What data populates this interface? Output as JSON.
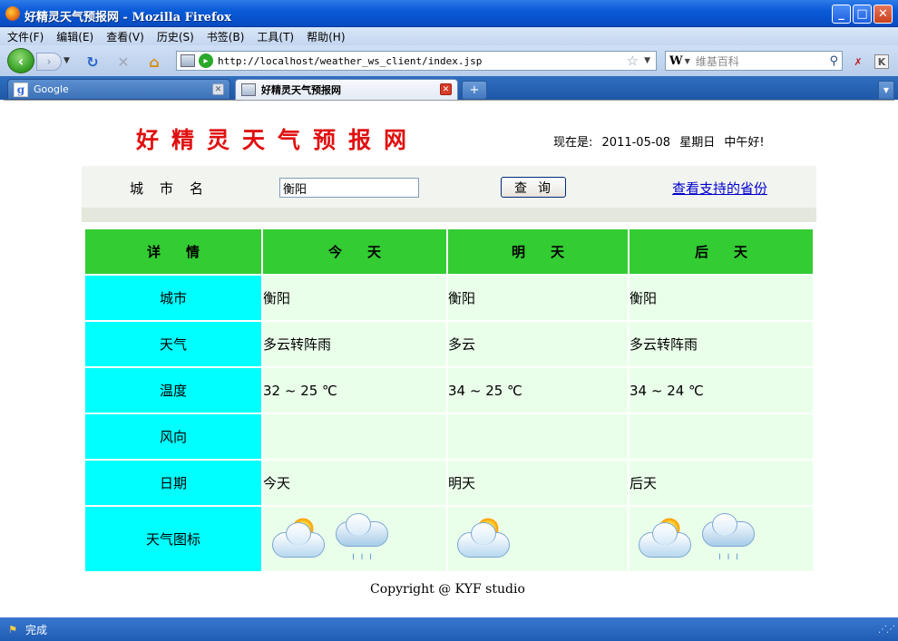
{
  "window": {
    "title": "好精灵天气预报网 - Mozilla Firefox",
    "min_icon": "minimize-icon",
    "max_icon": "maximize-icon",
    "close_icon": "close-icon"
  },
  "menubar": {
    "items": [
      "文件(F)",
      "编辑(E)",
      "查看(V)",
      "历史(S)",
      "书签(B)",
      "工具(T)",
      "帮助(H)"
    ]
  },
  "navbar": {
    "url": "http://localhost/weather_ws_client/index.jsp",
    "search_placeholder": "维基百科",
    "search_engine_label": "W"
  },
  "tabs": [
    {
      "label": "Google",
      "active": false
    },
    {
      "label": "好精灵天气预报网",
      "active": true
    }
  ],
  "page": {
    "site_title": "好精灵天气预报网",
    "date_prefix": "现在是:",
    "date": "2011-05-08",
    "weekday": "星期日",
    "greeting": "中午好!",
    "city_label": "城市名",
    "city_value": "衡阳",
    "query_button": "查询",
    "provinces_link": "查看支持的省份",
    "table": {
      "headers": [
        "详情",
        "今天",
        "明天",
        "后天"
      ],
      "rows": [
        {
          "label": "城市",
          "cells": [
            "衡阳",
            "衡阳",
            "衡阳"
          ]
        },
        {
          "label": "天气",
          "cells": [
            "多云转阵雨",
            "多云",
            "多云转阵雨"
          ]
        },
        {
          "label": "温度",
          "cells": [
            "32 ~ 25 ℃",
            "34 ~ 25 ℃",
            "34 ~ 24 ℃"
          ]
        },
        {
          "label": "风向",
          "cells": [
            "",
            "",
            ""
          ]
        },
        {
          "label": "日期",
          "cells": [
            "今天",
            "明天",
            "后天"
          ]
        }
      ],
      "icon_row_label": "天气图标",
      "icons": [
        [
          "partly-cloudy-icon",
          "showers-icon"
        ],
        [
          "partly-cloudy-icon"
        ],
        [
          "partly-cloudy-icon",
          "showers-icon"
        ]
      ]
    },
    "copyright": "Copyright @ KYF studio"
  },
  "statusbar": {
    "text": "完成"
  },
  "colors": {
    "title_red": "#e01010",
    "header_green": "#33cc33",
    "row_head_cyan": "#00ffff",
    "cell_bg": "#eaffea",
    "link_blue": "#0000cc"
  }
}
